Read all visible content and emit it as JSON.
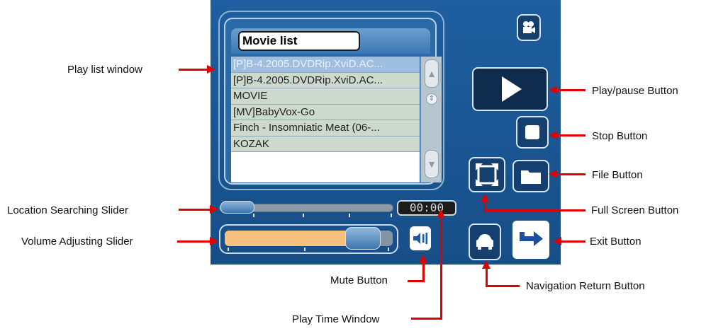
{
  "callouts": {
    "playlist_window": "Play list window",
    "play_pause": "Play/pause Button",
    "stop": "Stop Button",
    "file": "File Button",
    "full_screen": "Full Screen Button",
    "exit": "Exit Button",
    "location_slider": "Location Searching Slider",
    "volume_slider": "Volume Adjusting Slider",
    "mute": "Mute Button",
    "nav_return": "Navigation Return Button",
    "play_time": "Play Time Window"
  },
  "playlist": {
    "title": "Movie list",
    "items": [
      "[P]B-4.2005.DVDRip.XviD.AC...",
      "[P]B-4.2005.DVDRip.XviD.AC...",
      "MOVIE",
      "[MV]BabyVox-Go",
      "Finch - Insomniatic Meat (06-...",
      "KOZAK"
    ],
    "selected_index": 0
  },
  "player": {
    "time": "00:00",
    "position": 0.0,
    "volume": 0.78
  },
  "icons": {
    "camera": "video-camera-icon",
    "play": "play-icon",
    "stop": "stop-icon",
    "full_screen": "full-screen-icon",
    "file": "folder-icon",
    "mute": "speaker-icon",
    "nav": "car-icon",
    "exit": "exit-arrow-icon"
  },
  "colors": {
    "panel": "#1a5794",
    "callout_arrow": "#e00000",
    "volume_fill": "#f7c07f"
  }
}
